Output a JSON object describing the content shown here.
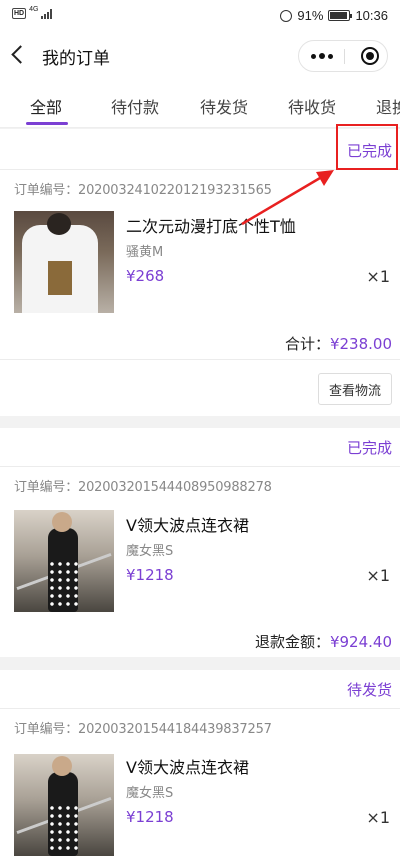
{
  "status_bar": {
    "network_badge": "HD",
    "network_type": "4G",
    "battery_percent": "91%",
    "time": "10:36"
  },
  "nav": {
    "title": "我的订单",
    "icons": [
      "back-icon",
      "more-icon",
      "close-target-icon"
    ]
  },
  "tabs": [
    {
      "label": "全部",
      "active": true
    },
    {
      "label": "待付款"
    },
    {
      "label": "待发货"
    },
    {
      "label": "待收货"
    },
    {
      "label": "退换"
    }
  ],
  "accent_color": "#7b3fd3",
  "annotation_color": "#e82020",
  "orders": [
    {
      "status": "已完成",
      "order_no_label": "订单编号：",
      "order_no": "20200324102201219323156 5",
      "product_name": "二次元动漫打底个性T恤",
      "spec": "骚黄M",
      "price": "¥268",
      "qty": "×1",
      "total_label": "合计：",
      "total_amount": "¥238.00",
      "action_label": "查看物流"
    },
    {
      "status": "已完成",
      "order_no_label": "订单编号：",
      "order_no": "20200320154440895098827 8",
      "product_name": "V领大波点连衣裙",
      "spec": "魔女黑S",
      "price": "¥1218",
      "qty": "×1",
      "total_label": "退款金额：",
      "total_amount": "¥924.40"
    },
    {
      "status": "待发货",
      "order_no_label": "订单编号：",
      "order_no": "20200320154418443983725 7",
      "product_name": "V领大波点连衣裙",
      "spec": "魔女黑S",
      "price": "¥1218",
      "qty": "×1"
    }
  ]
}
